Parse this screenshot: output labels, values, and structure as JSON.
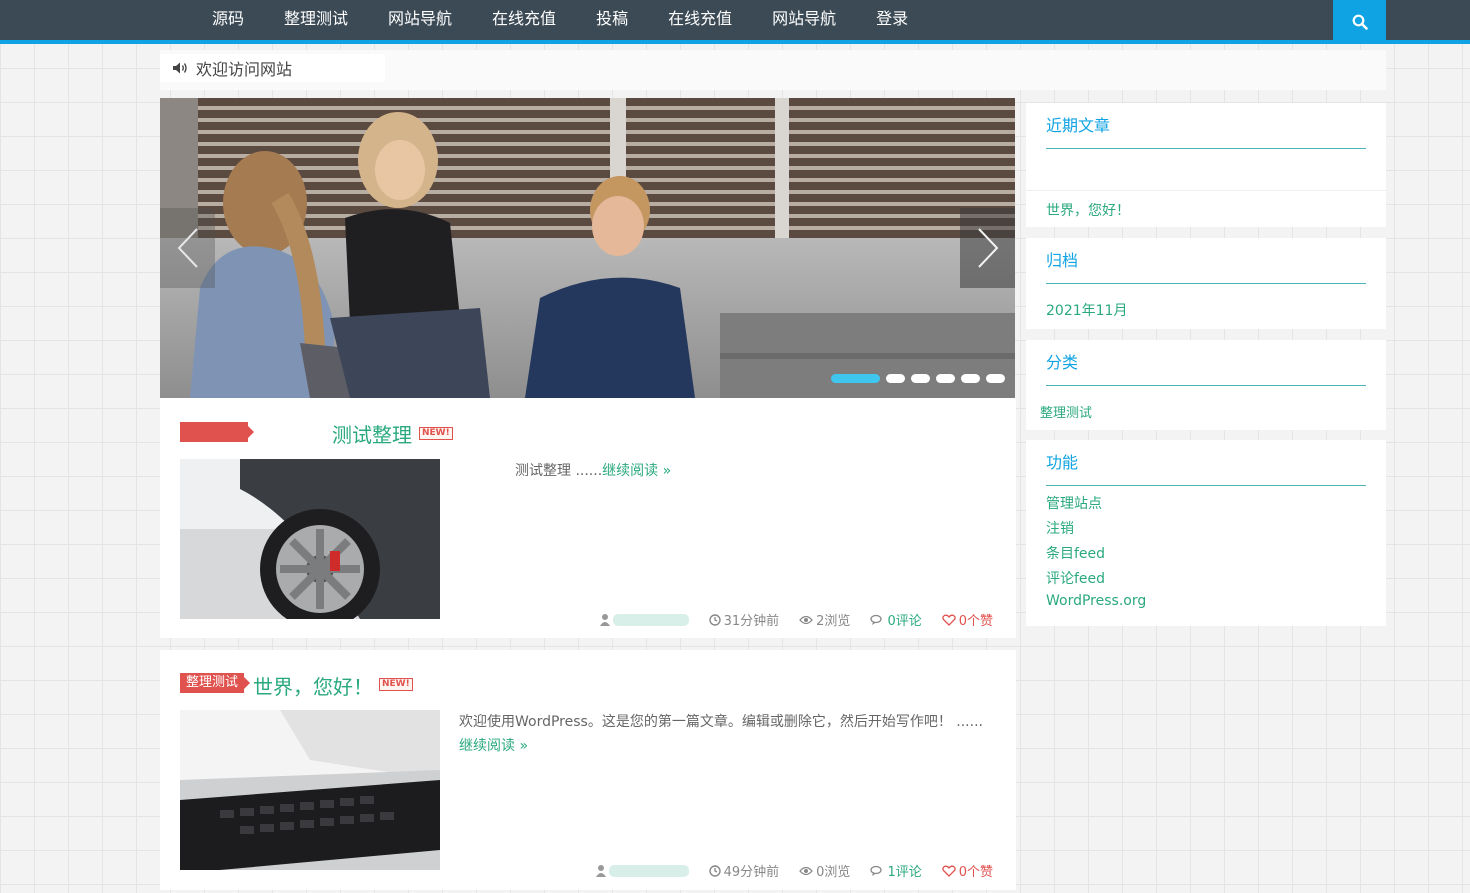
{
  "nav": {
    "items": [
      "源码",
      "整理测试",
      "网站导航",
      "在线充值",
      "投稿",
      "在线充值",
      "网站导航",
      "登录"
    ]
  },
  "notice": {
    "text": "欢迎访问网站"
  },
  "slider": {
    "dot_count": 6,
    "active_index": 0
  },
  "posts": [
    {
      "category": "",
      "title": "测试整理",
      "badge": "NEW!",
      "excerpt": "测试整理 ......",
      "read_more": "继续阅读 »",
      "time": "31分钟前",
      "views": "2浏览",
      "comments": "0评论",
      "likes": "0个赞"
    },
    {
      "category": "整理测试",
      "title": "世界，您好！",
      "badge": "NEW!",
      "excerpt": "欢迎使用WordPress。这是您的第一篇文章。编辑或删除它，然后开始写作吧！ ......",
      "read_more": "继续阅读 »",
      "time": "49分钟前",
      "views": "0浏览",
      "comments": "1评论",
      "likes": "0个赞"
    }
  ],
  "sidebar": {
    "recent": {
      "title": "近期文章",
      "items": [
        "世界，您好！"
      ]
    },
    "archive": {
      "title": "归档",
      "items": [
        "2021年11月"
      ]
    },
    "categories": {
      "title": "分类",
      "items": [
        "整理测试"
      ]
    },
    "meta": {
      "title": "功能",
      "items": [
        "管理站点",
        "注销",
        "条目feed",
        "评论feed",
        "WordPress.org"
      ]
    }
  },
  "colors": {
    "accent": "#10a3e3",
    "nav_bg": "#3b4a55",
    "link": "#2aa97e",
    "tag": "#e0524e"
  }
}
